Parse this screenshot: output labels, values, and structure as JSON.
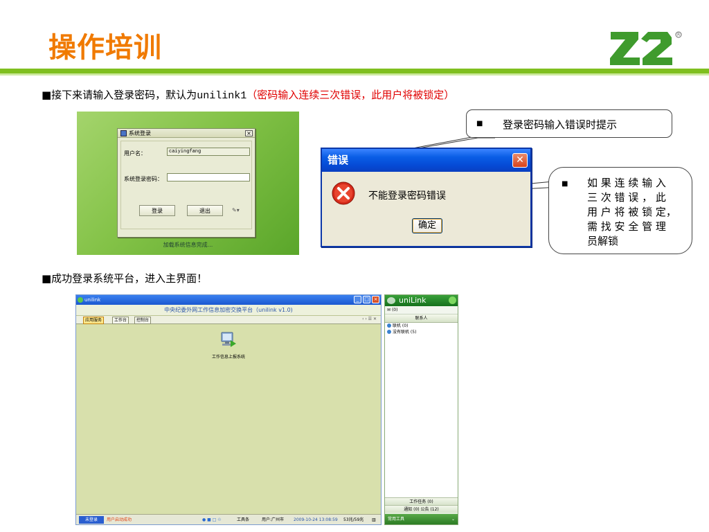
{
  "slide": {
    "title": "操作培训",
    "logo_text": "Z2",
    "line1_prefix": "■接下来请输入登录密码，默认为",
    "line1_password": "unilink1",
    "line1_note": "（密码输入连续三次错误，此用户将被锁定）",
    "line2": "■成功登录系统平台，进入主界面！",
    "colors": {
      "title": "#f07a00",
      "accent_bar": "#7fbf1f",
      "note": "#e00000"
    }
  },
  "login_dialog": {
    "title": "系统登录",
    "username_label": "用户名：",
    "username_value": "caiyingfang",
    "password_label": "系统登录密码：",
    "password_value": "",
    "login_button": "登录",
    "exit_button": "退出",
    "settings_glyph": "✎▾",
    "status": "加载系统信息完成..."
  },
  "callout1": {
    "bullet": "■",
    "text": "登录密码输入错误时提示"
  },
  "callout2": {
    "bullet": "■",
    "lines": [
      "如 果 连 续 输 入",
      "三 次 错 误 ， 此",
      "用 户 将 被 锁 定，",
      "需 找 安 全 管 理",
      "员解锁"
    ]
  },
  "error_dialog": {
    "title": "错误",
    "message": "不能登录密码错误",
    "ok_button": "确定",
    "close_glyph": "✕"
  },
  "main_app": {
    "window_title": "unilink",
    "header": "中央纪委外网工作信息加密交换平台（unilink v1.0)",
    "tabs": [
      "应用服务",
      "工作台",
      "控制台"
    ],
    "tab_controls": "‹ › ☰ ✕",
    "desktop_item": "工作信息上报系统",
    "status": {
      "start": "未登录",
      "message": "用户启动成功",
      "toolbox": "工具条",
      "user": "用户:广州市",
      "datetime": "2009-10-24 13:08:59",
      "counts": "53兆/59兆"
    }
  },
  "unilink_panel": {
    "brand": "uniLink",
    "status_line": "(0)",
    "contacts_header": "联系人",
    "groups": [
      "联机 (0)",
      "没有联机 (5)"
    ],
    "work_tasks": "工作任务 (0)",
    "notices": "通知 (0) 公告 (12)",
    "footer": "常用工具"
  }
}
